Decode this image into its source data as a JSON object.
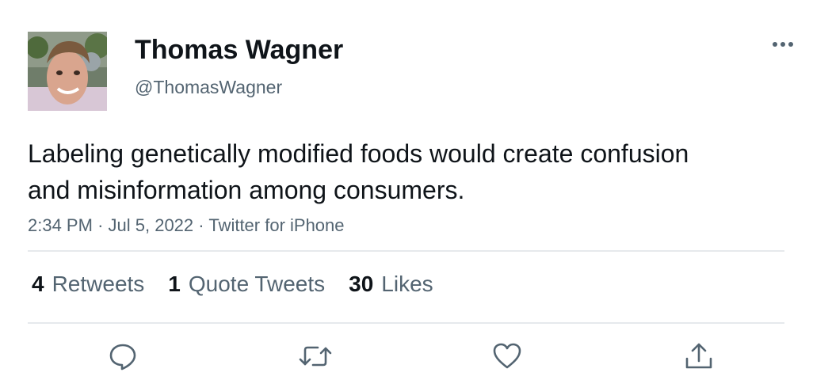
{
  "user": {
    "display_name": "Thomas Wagner",
    "handle": "@ThomasWagner",
    "avatar_icon": "profile-photo"
  },
  "more_icon": "more-horizontal-icon",
  "tweet": {
    "text": "Labeling genetically modified foods would create confusion and misinformation among consumers."
  },
  "meta": {
    "time": "2:34 PM",
    "separator": "·",
    "date": "Jul 5, 2022",
    "source": "Twitter for iPhone"
  },
  "stats": {
    "retweets_count": "4",
    "retweets_label": "Retweets",
    "quotes_count": "1",
    "quotes_label": "Quote Tweets",
    "likes_count": "30",
    "likes_label": "Likes"
  },
  "actions": [
    {
      "icon": "reply-icon"
    },
    {
      "icon": "retweet-icon"
    },
    {
      "icon": "like-icon"
    },
    {
      "icon": "share-icon"
    }
  ],
  "colors": {
    "text": "#0f1419",
    "secondary_text": "#536471",
    "divider": "#e6e9ec"
  }
}
